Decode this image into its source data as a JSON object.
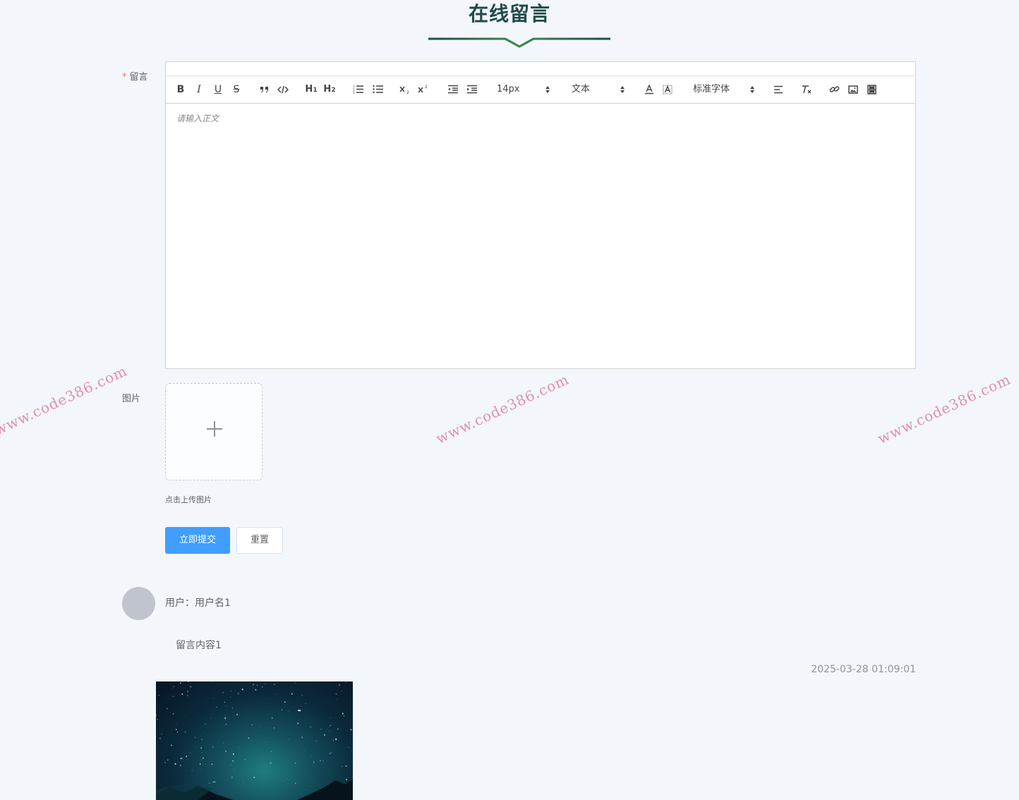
{
  "page": {
    "title": "在线留言"
  },
  "form": {
    "message_label": "留言",
    "required_mark": "*",
    "image_label": "图片",
    "editor": {
      "placeholder": "请输入正文",
      "font_size_value": "14px",
      "header_value": "文本",
      "font_family_value": "标准字体",
      "toolbar_icons": [
        "bold-icon",
        "italic-icon",
        "underline-icon",
        "strike-icon",
        "blockquote-icon",
        "code-block-icon",
        "h1-icon",
        "h2-icon",
        "ordered-list-icon",
        "bullet-list-icon",
        "subscript-icon",
        "superscript-icon",
        "outdent-icon",
        "indent-icon",
        "font-color-icon",
        "background-color-icon",
        "align-icon",
        "clear-format-icon",
        "link-icon",
        "image-icon",
        "video-icon"
      ],
      "labels": {
        "bold": "B",
        "italic": "I",
        "underline": "U",
        "strike": "S",
        "h1": "H1",
        "h2": "H2"
      }
    },
    "upload_tip": "点击上传图片",
    "submit_label": "立即提交",
    "reset_label": "重置"
  },
  "comments": [
    {
      "user": "用户：用户名1",
      "content": "留言内容1",
      "time": "2025-03-28 01:09:01"
    }
  ],
  "watermark": "www.code386.com",
  "colors": {
    "title": "#1f4b4a",
    "accent_line": "#2f6b4f",
    "primary": "#409eff",
    "required": "#f56c6c",
    "watermark": "#dc6e8c"
  }
}
